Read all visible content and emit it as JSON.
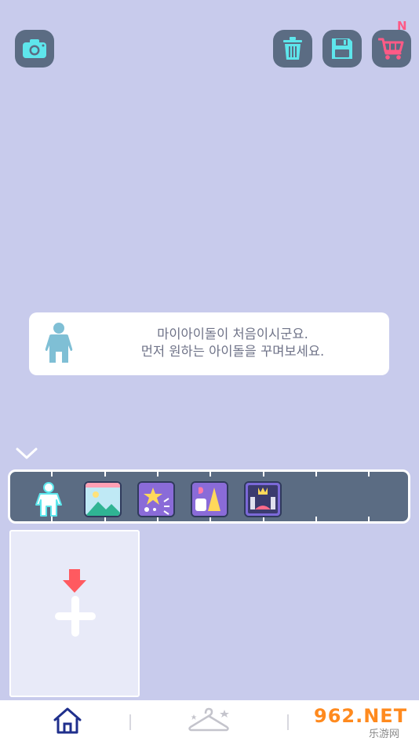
{
  "toolbar": {
    "camera_icon": "camera-icon",
    "trash_icon": "trash-icon",
    "save_icon": "floppy-disk-icon",
    "cart_icon": "shopping-cart-icon",
    "cart_badge": "N"
  },
  "toast": {
    "line1": "마이아이돌이 처음이시군요.",
    "line2": "먼저 원하는 아이돌을 꾸며보세요."
  },
  "categories": [
    {
      "icon": "character-body-icon",
      "selected": true
    },
    {
      "icon": "background-landscape-icon"
    },
    {
      "icon": "star-effect-icon"
    },
    {
      "icon": "letter-sticker-icon"
    },
    {
      "icon": "stage-frame-icon"
    }
  ],
  "colors": {
    "background": "#c8cbec",
    "button": "#5b6c83",
    "accent_cyan": "#5ee6ec",
    "arrow_red": "#ff5a60",
    "badge_pink": "#ff5a86"
  },
  "watermark": {
    "text": "962.NET",
    "sub": "乐游网"
  }
}
